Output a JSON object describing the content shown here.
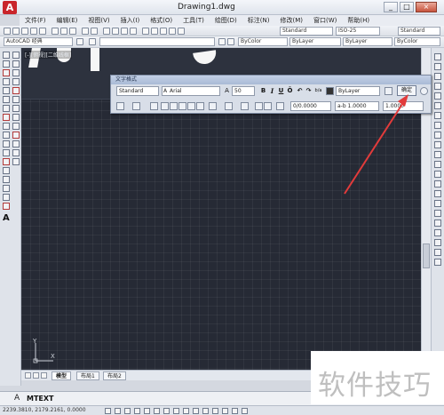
{
  "window": {
    "title": "Drawing1.dwg",
    "app_logo": "A",
    "minimize": "_",
    "maximize": "□",
    "close": "×"
  },
  "menu": [
    "文件(F)",
    "编辑(E)",
    "视图(V)",
    "插入(I)",
    "格式(O)",
    "工具(T)",
    "绘图(D)",
    "标注(N)",
    "修改(M)",
    "窗口(W)",
    "帮助(H)"
  ],
  "toolbar2": {
    "text_style": "Standard",
    "dim_style": "ISO-25",
    "table_style": "Standard"
  },
  "toolbar3": {
    "workspace": "AutoCAD 经典",
    "layer_color": "ByColor",
    "linetype": "ByLayer",
    "lineweight": "ByLayer",
    "plot_style": "ByColor"
  },
  "viewport": {
    "label": "[-][俯视][二维线框]"
  },
  "text_editor": {
    "title": "文字格式",
    "style": "Standard",
    "font": "Arial",
    "font_prefix": "A",
    "height": "50",
    "bold": "B",
    "italic": "I",
    "underline": "U",
    "overline": "Ō",
    "undo": "↶",
    "redo": "↷",
    "stack": "b/a",
    "color": "ByLayer",
    "ok": "确定",
    "oblique": "0/0.0000",
    "tracking": "a-b 1.0000",
    "width": "1.0000"
  },
  "layout_tabs": [
    "模型",
    "布局1",
    "布局2"
  ],
  "command": {
    "prefix": "A",
    "text": "MTEXT"
  },
  "status": {
    "coords": "2239.3810,  2179.2161,  0.0000"
  },
  "watermark": "软件技巧",
  "colors": {
    "canvas": "#262a35",
    "arrow": "#e23b3b"
  }
}
